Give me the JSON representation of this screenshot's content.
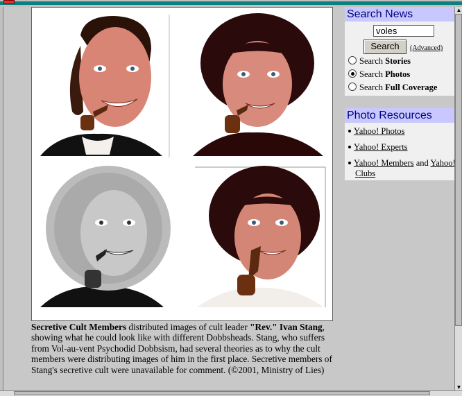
{
  "search_news": {
    "title": "Search News",
    "query": "voles",
    "button": "Search",
    "advanced": "(Advanced)",
    "options": [
      {
        "prefix": "Search ",
        "bold": "Stories",
        "selected": false
      },
      {
        "prefix": "Search ",
        "bold": "Photos",
        "selected": true
      },
      {
        "prefix": "Search ",
        "bold": "Full Coverage",
        "selected": false
      }
    ]
  },
  "photo_resources": {
    "title": "Photo Resources",
    "items": [
      {
        "link": "Yahoo! Photos",
        "rest": ""
      },
      {
        "link": "Yahoo! Experts",
        "rest": ""
      },
      {
        "link": "Yahoo! Members",
        "rest": " and ",
        "link2": "Yahoo!",
        "line2": "Clubs"
      }
    ]
  },
  "caption": {
    "bold1": "Secretive Cult Members",
    "text1": " distributed images of cult leader ",
    "bold2": "\"Rev.\" Ivan Stang",
    "text2": ", showing what he could look like with different Dobbsheads. Stang, who suffers from Vol-au-vent Psychodid Dobbsism, had several theories as to why the cult members were distributing images of him in the first place.  Secretive members of Stang's secretive cult were unavailable for comment. (©2001, Ministry of Lies)"
  },
  "colors": {
    "panel_header_bg": "#c8c8ff",
    "panel_header_text": "#000080",
    "window_title_bar": "#0c7f7f"
  }
}
